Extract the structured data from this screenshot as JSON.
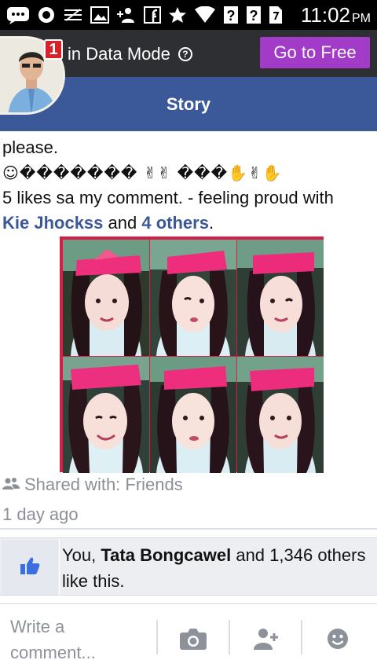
{
  "status_bar": {
    "time": "11:02",
    "ampm": "PM",
    "icons": [
      "bbm-icon",
      "record-icon",
      "equalizer-icon",
      "image-icon",
      "add-user-icon",
      "facebook-icon",
      "star-icon",
      "wifi-icon",
      "unknown-icon",
      "unknown-icon",
      "sim-icon",
      "battery-icon"
    ],
    "unknown_glyph": "?"
  },
  "data_mode": {
    "text": "in Data Mode",
    "go_free": "Go to Free"
  },
  "header": {
    "title": "Story",
    "notification_count": "1"
  },
  "post": {
    "line1": "please.",
    "line2": "☺������� ✌✌ ���✋✌✋",
    "line3": "5 likes sa my comment. - feeling proud with",
    "tagged_name": "Kie Jhockss",
    "and": "and",
    "others": "4 others",
    "period": "."
  },
  "meta": {
    "shared": "Shared with: Friends",
    "time_ago": "1 day ago"
  },
  "likes": {
    "you": "You, ",
    "name": "Tata Bongcawel",
    "rest": " and 1,346 others like this."
  },
  "comment": {
    "placeholder": "Write a comment..."
  },
  "colors": {
    "facebook_blue": "#3b5998",
    "go_free_purple": "#a23bc7",
    "data_bar": "#2d2f33",
    "badge_red": "#d8222a",
    "photo_border": "#d41f48"
  }
}
